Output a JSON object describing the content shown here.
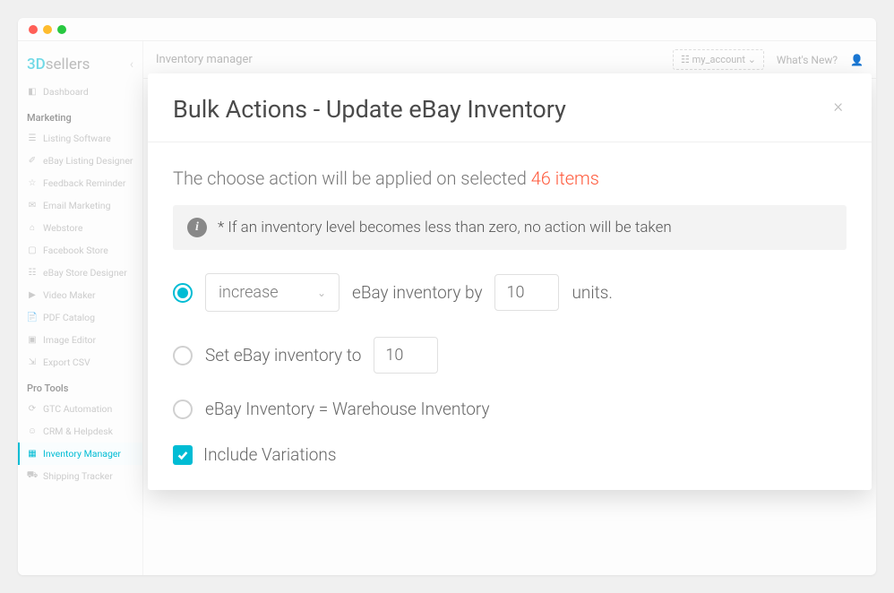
{
  "app": {
    "logo_prefix": "3D",
    "logo_suffix": "sellers",
    "header_title": "Inventory manager",
    "account_label": "my_account",
    "whats_new": "What's New?"
  },
  "sidebar": {
    "item_dashboard": "Dashboard",
    "group_marketing": "Marketing",
    "item_listing_software": "Listing Software",
    "item_listing_designer": "eBay Listing Designer",
    "item_feedback": "Feedback Reminder",
    "item_email_marketing": "Email Marketing",
    "item_webstore": "Webstore",
    "item_facebook": "Facebook Store",
    "item_store_designer": "eBay Store Designer",
    "item_video": "Video Maker",
    "item_pdf": "PDF Catalog",
    "item_image": "Image Editor",
    "item_export": "Export CSV",
    "group_pro": "Pro Tools",
    "item_gtc": "GTC Automation",
    "item_crm": "CRM & Helpdesk",
    "item_inventory": "Inventory Manager",
    "item_shipping": "Shipping Tracker"
  },
  "modal": {
    "title": "Bulk Actions - Update eBay Inventory",
    "summary_prefix": "The choose action will be applied on selected ",
    "summary_count": "46 items",
    "info_note": "* If an inventory level becomes less than zero, no action will be taken",
    "option1_select_value": "increase",
    "option1_mid": "eBay inventory by",
    "option1_value": "10",
    "option1_suffix": "units.",
    "option2_prefix": "Set eBay inventory to",
    "option2_value": "10",
    "option3_text": "eBay Inventory = Warehouse Inventory",
    "include_variations": "Include Variations"
  }
}
